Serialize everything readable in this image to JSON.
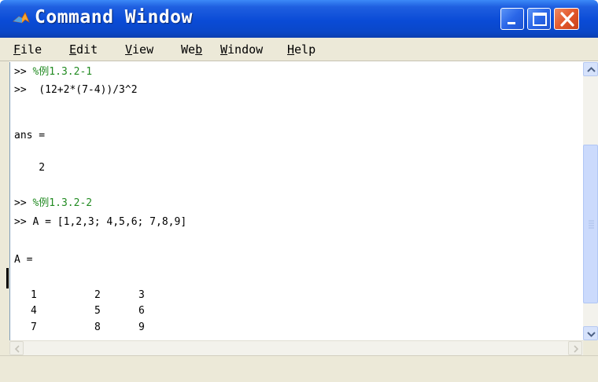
{
  "window": {
    "title": "Command Window",
    "icon": "matlab-logo-icon"
  },
  "title_buttons": {
    "minimize": "minimize-icon",
    "maximize": "maximize-icon",
    "close": "close-icon"
  },
  "menu": {
    "file": {
      "u": "F",
      "rest": "ile"
    },
    "edit": {
      "u": "E",
      "rest": "dit"
    },
    "view": {
      "u": "V",
      "rest": "iew"
    },
    "web": {
      "pre": "We",
      "u": "b"
    },
    "window": {
      "u": "W",
      "rest": "indow"
    },
    "help": {
      "u": "H",
      "rest": "elp"
    }
  },
  "console": {
    "l1_prompt": ">> ",
    "l1_comment": "%例1.3.2-1",
    "l2": ">>  (12+2*(7-4))/3^2",
    "l3": "ans =",
    "l4": "    2",
    "l5_prompt": ">> ",
    "l5_comment": "%例1.3.2-2",
    "l6": ">> A = [1,2,3; 4,5,6; 7,8,9]",
    "l7": "A ="
  },
  "matrix": [
    [
      "1",
      "2",
      "3"
    ],
    [
      "4",
      "5",
      "6"
    ],
    [
      "7",
      "8",
      "9"
    ]
  ],
  "colors": {
    "comment": "#228b22",
    "titlebar": "#0a4bd6",
    "close_button": "#e2582b"
  }
}
